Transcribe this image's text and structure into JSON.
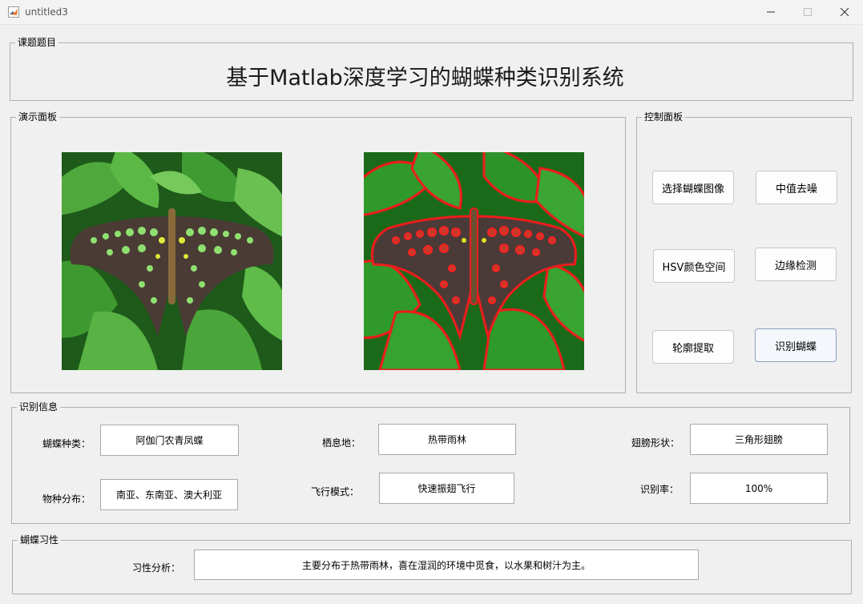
{
  "window": {
    "title": "untitled3"
  },
  "topic_panel": {
    "legend": "课题题目",
    "title": "基于Matlab深度学习的蝴蝶种类识别系统"
  },
  "demo_panel": {
    "legend": "演示面板"
  },
  "control_panel": {
    "legend": "控制面板",
    "buttons": {
      "select_image": "选择蝴蝶图像",
      "median_denoise": "中值去噪",
      "hsv": "HSV颜色空间",
      "edge_detect": "边缘检测",
      "contour": "轮廓提取",
      "identify": "识别蝴蝶"
    }
  },
  "info_panel": {
    "legend": "识别信息",
    "species_label": "蝴蝶种类：",
    "species": "阿伽门农青凤蝶",
    "habitat_label": "栖息地：",
    "habitat": "热带雨林",
    "wing_label": "翅膀形状：",
    "wing": "三角形翅膀",
    "distribution_label": "物种分布：",
    "distribution": "南亚、东南亚、澳大利亚",
    "flight_label": "飞行模式：",
    "flight": "快速振翅飞行",
    "rate_label": "识别率：",
    "rate": "100%"
  },
  "habit_panel": {
    "legend": "蝴蝶习性",
    "analysis_label": "习性分析：",
    "analysis": "主要分布于热带雨林，喜在湿润的环境中觅食，以水果和树汁为主。"
  },
  "icons": [
    "matlab-icon",
    "minimize-icon",
    "maximize-icon",
    "close-icon"
  ]
}
